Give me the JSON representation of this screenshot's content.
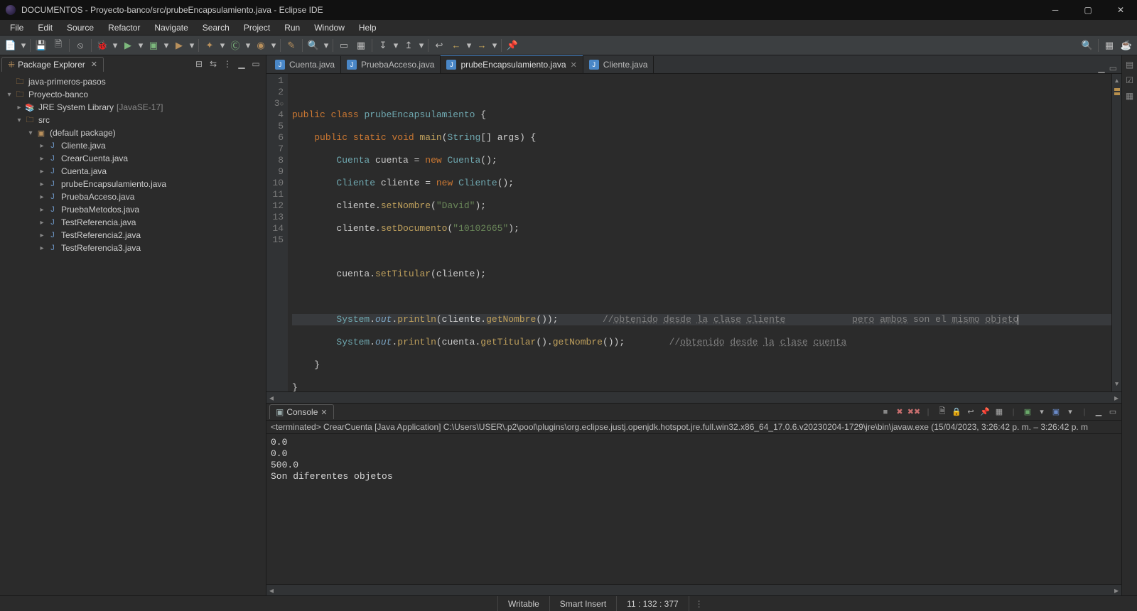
{
  "window": {
    "title": "DOCUMENTOS - Proyecto-banco/src/prubeEncapsulamiento.java - Eclipse IDE"
  },
  "menu": {
    "file": "File",
    "edit": "Edit",
    "source": "Source",
    "refactor": "Refactor",
    "navigate": "Navigate",
    "search": "Search",
    "project": "Project",
    "run": "Run",
    "window": "Window",
    "help": "Help"
  },
  "pkg_explorer": {
    "title": "Package Explorer",
    "project1": "java-primeros-pasos",
    "project2": "Proyecto-banco",
    "jre": "JRE System Library",
    "jre_profile": "[JavaSE-17]",
    "src": "src",
    "default_pkg": "(default package)",
    "files": {
      "cliente": "Cliente.java",
      "crearcuenta": "CrearCuenta.java",
      "cuenta": "Cuenta.java",
      "prube": "prubeEncapsulamiento.java",
      "pruebaacceso": "PruebaAcceso.java",
      "pruebametodos": "PruebaMetodos.java",
      "test1": "TestReferencia.java",
      "test2": "TestReferencia2.java",
      "test3": "TestReferencia3.java"
    }
  },
  "tabs": {
    "cuenta": "Cuenta.java",
    "pruebaacceso": "PruebaAcceso.java",
    "prube": "prubeEncapsulamiento.java",
    "cliente": "Cliente.java"
  },
  "code": {
    "kw_public": "public",
    "kw_class": "class",
    "kw_static": "static",
    "kw_void": "void",
    "kw_new": "new",
    "classname": "prubeEncapsulamiento",
    "main": "main",
    "string_arr": "String[] args",
    "type_cuenta": "Cuenta",
    "type_cliente": "Cliente",
    "var_cuenta": "cuenta",
    "var_cliente": "cliente",
    "setNombre": "setNombre",
    "setDocumento": "setDocumento",
    "setTitular": "setTitular",
    "getNombre": "getNombre",
    "getTitular": "getTitular",
    "system": "System",
    "out": "out",
    "println": "println",
    "lit_david": "\"David\"",
    "lit_doc": "\"10102665\"",
    "comment11": "//obtenido desde la clase cliente            pero ambos son el mismo objeto",
    "comment12": "//obtenido desde la clase cuenta"
  },
  "console": {
    "title": "Console",
    "run_info": "<terminated> CrearCuenta [Java Application] C:\\Users\\USER\\.p2\\pool\\plugins\\org.eclipse.justj.openjdk.hotspot.jre.full.win32.x86_64_17.0.6.v20230204-1729\\jre\\bin\\javaw.exe  (15/04/2023, 3:26:42 p. m. – 3:26:42 p. m",
    "l1": "0.0",
    "l2": "0.0",
    "l3": "500.0",
    "l4": "Son diferentes objetos"
  },
  "status": {
    "writable": "Writable",
    "insert": "Smart Insert",
    "pos": "11 : 132 : 377"
  }
}
